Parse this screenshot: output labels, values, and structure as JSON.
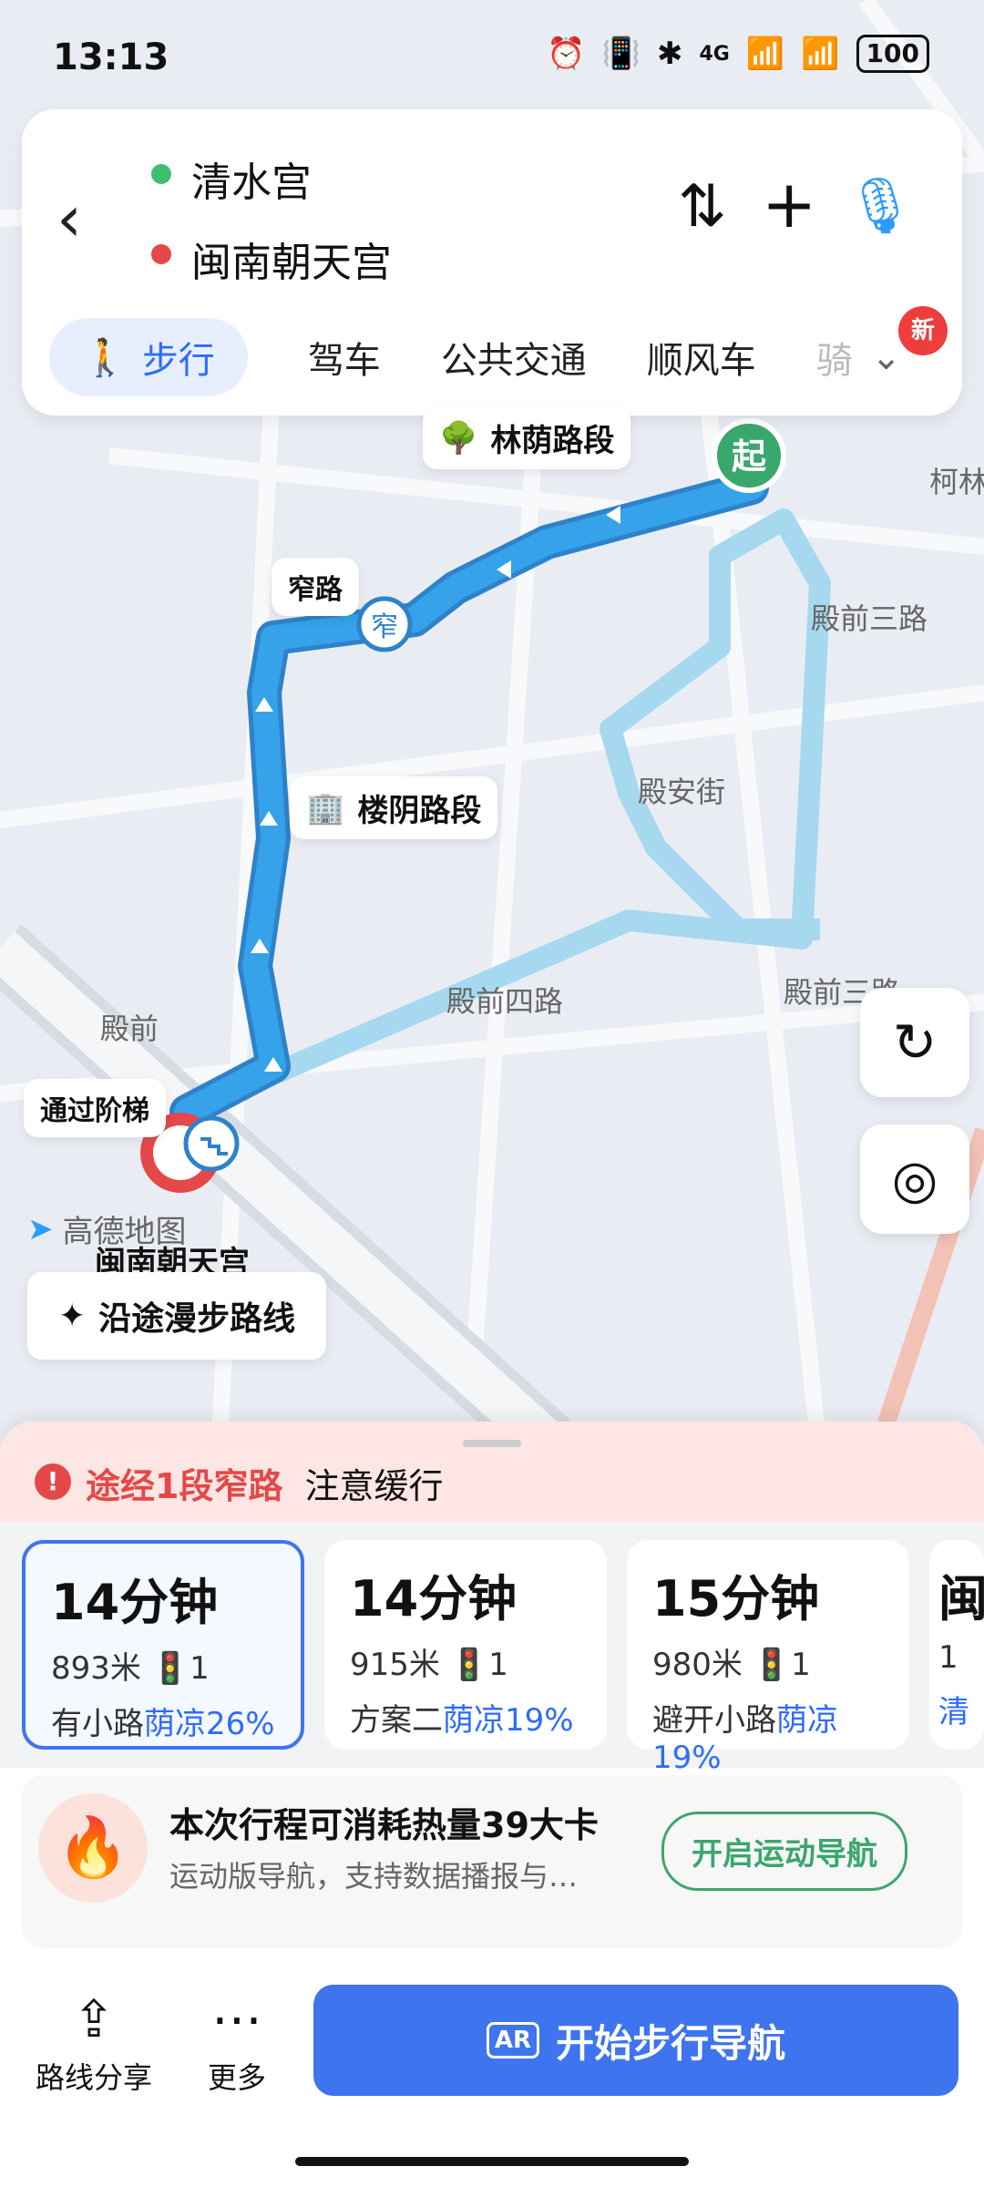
{
  "status": {
    "time": "13:13",
    "network": "4G",
    "battery": "100"
  },
  "route": {
    "start": "清水宫",
    "end": "闽南朝天宫",
    "tabs": [
      "步行",
      "驾车",
      "公共交通",
      "顺风车",
      "骑"
    ],
    "new_badge": "新"
  },
  "map": {
    "labels": {
      "lin_yin": "林荫路段",
      "narrow": "窄路",
      "narrow_badge": "窄",
      "building_shade": "楼阴路段",
      "pass_stairs": "通过阶梯",
      "start_marker": "起",
      "destination": "闽南朝天宫",
      "logo": "高德地图",
      "stroll_btn": "沿途漫步路线"
    },
    "streets": [
      "殿前三路",
      "殿安街",
      "殿前四路",
      "殿前三路",
      "殿前",
      "柯林"
    ]
  },
  "panel": {
    "warning_main": "途经1段窄路",
    "warning_sub": "注意缓行",
    "routes": [
      {
        "time": "14分钟",
        "dist": "893米",
        "lights": "1",
        "desc": "有小路",
        "shade": "荫凉26%"
      },
      {
        "time": "14分钟",
        "dist": "915米",
        "lights": "1",
        "desc": "方案二",
        "shade": "荫凉19%"
      },
      {
        "time": "15分钟",
        "dist": "980米",
        "lights": "1",
        "desc": "避开小路",
        "shade": "荫凉19%"
      },
      {
        "time": "闽",
        "dist": "1",
        "lights": "",
        "desc": "",
        "shade": "清"
      }
    ],
    "calorie_title": "本次行程可消耗热量39大卡",
    "calorie_desc": "运动版导航，支持数据播报与…",
    "sport_nav_btn": "开启运动导航"
  },
  "bottom": {
    "share": "路线分享",
    "more": "更多",
    "start_nav": "开始步行导航"
  },
  "colors": {
    "route_primary": "#35a2ea",
    "route_secondary": "#a6d8ef",
    "accent_blue": "#2f6bff",
    "start_green": "#3aa76d",
    "warning_red": "#e54848"
  }
}
